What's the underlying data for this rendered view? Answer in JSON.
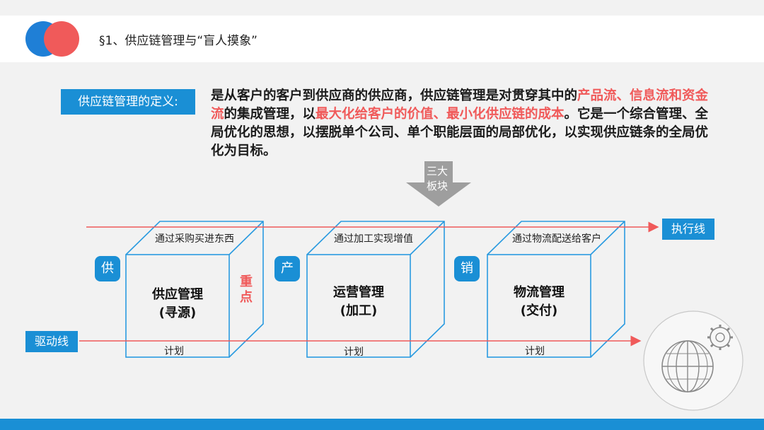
{
  "header": {
    "title": "§1、供应链管理与“盲人摸象”"
  },
  "definition": {
    "label": "供应链管理的定义:",
    "text_parts": [
      {
        "text": "是从客户的客户到供应商的供应商，供应链管理是对贯穿其中的",
        "highlight": false
      },
      {
        "text": "产品流、信息流和资金流",
        "highlight": true
      },
      {
        "text": "的集成管理，以",
        "highlight": false
      },
      {
        "text": "最大化给客户的价值、最小化供应链的成本",
        "highlight": true
      },
      {
        "text": "。它是一个综合管理、全局优化的思想，以摆脱单个公司、单个职能层面的局部优化，以实现供应链条的全局优化为目标。",
        "highlight": false
      }
    ]
  },
  "arrow": {
    "line1": "三大",
    "line2": "板块"
  },
  "lines": {
    "exec": "执行线",
    "drive": "驱动线"
  },
  "boxes": [
    {
      "tag": "供",
      "top_text": "通过采购买进东西",
      "title": "供应管理",
      "subtitle": "(寻源)",
      "bottom_text": "计划"
    },
    {
      "tag": "产",
      "top_text": "通过加工实现增值",
      "title": "运营管理",
      "subtitle": "(加工)",
      "bottom_text": "计划"
    },
    {
      "tag": "销",
      "top_text": "通过物流配送给客户",
      "title": "物流管理",
      "subtitle": "(交付)",
      "bottom_text": "计划"
    }
  ],
  "focus": "重点",
  "colors": {
    "blue": "#1a8fd5",
    "red": "#f05a5a",
    "cube_stroke": "#2a9be0"
  },
  "icons": [
    "globe-gear-icon"
  ]
}
